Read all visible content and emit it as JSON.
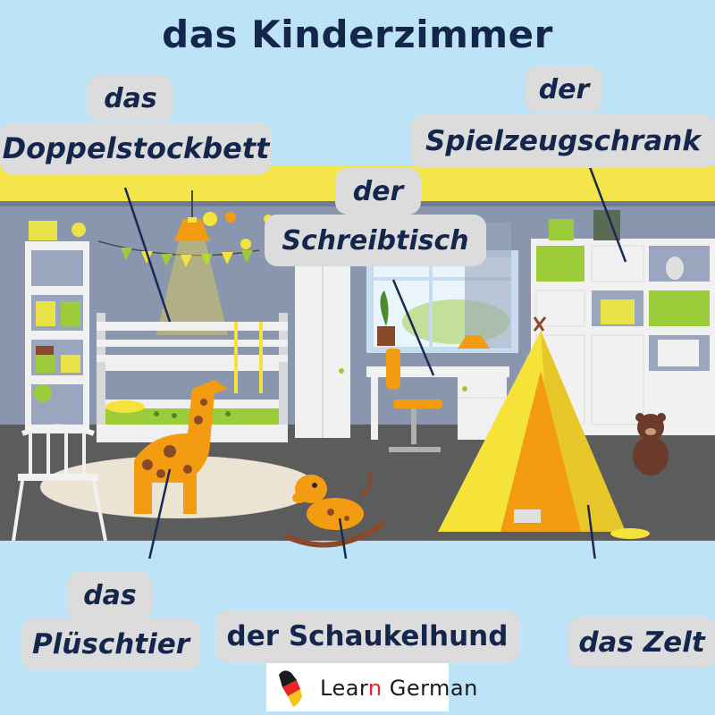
{
  "title": "das Kinderzimmer",
  "labels": {
    "bed_article": "das",
    "bed_noun": "Doppelstockbett",
    "cabinet_article": "der",
    "cabinet_noun": "Spielzeugschrank",
    "desk_article": "der",
    "desk_noun": "Schreibtisch",
    "plush_article": "das",
    "plush_noun": "Plüschtier",
    "rocking_dog": "der Schaukelhund",
    "tent": "das Zelt"
  },
  "logo": {
    "text_part1": "Lear",
    "text_part2": "n",
    "text_part3": " German"
  },
  "colors": {
    "background": "#bde3f7",
    "title": "#15264d",
    "label_bg": "#dcdcdc",
    "wall": "#8a96ad",
    "floor": "#5c5c5c",
    "accent_yellow": "#f6e33a",
    "accent_orange": "#f39c12",
    "accent_green": "#9ccc3a"
  },
  "icons": [
    "germany-heart-logo-icon",
    "arrow-icon"
  ]
}
